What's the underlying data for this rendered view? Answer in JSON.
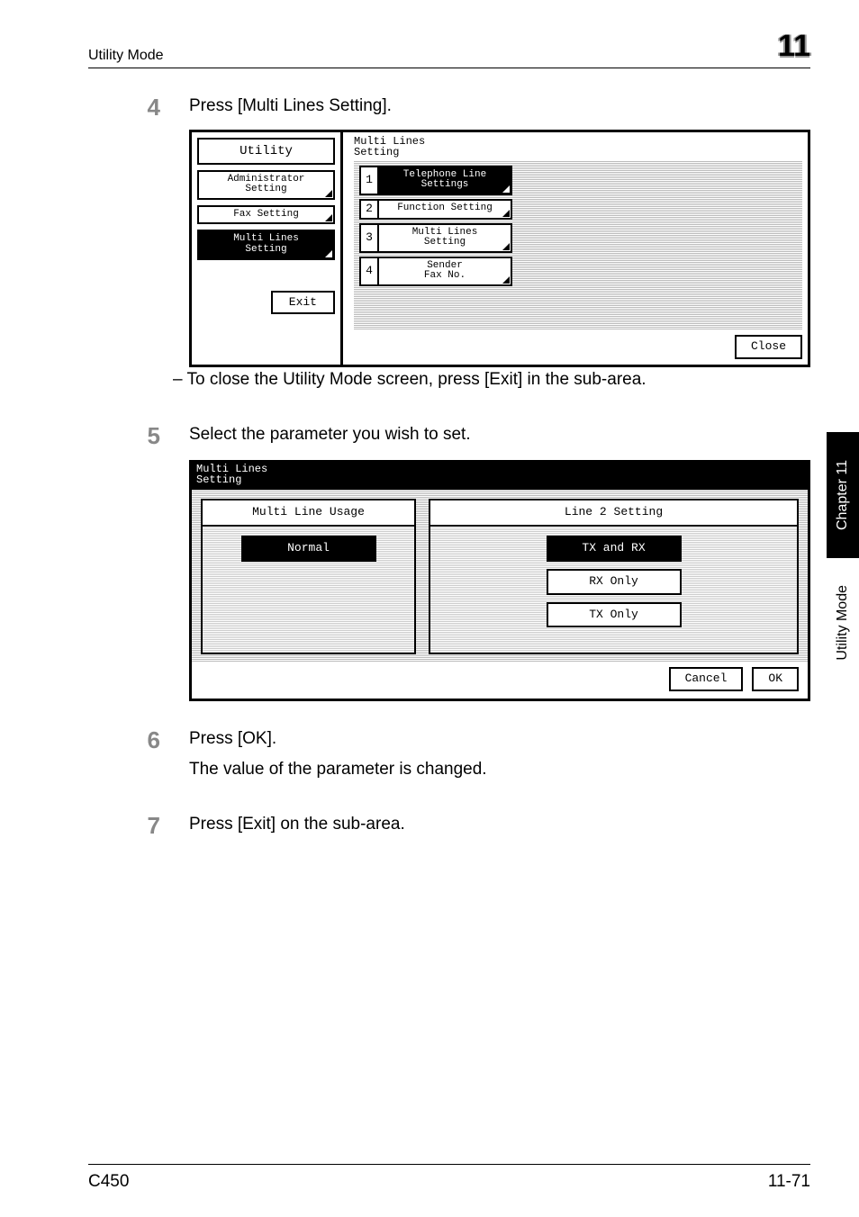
{
  "header": {
    "title": "Utility Mode",
    "chapter_number": "11"
  },
  "side_tab": {
    "chapter_label": "Chapter 11",
    "mode_label": "Utility Mode"
  },
  "steps": {
    "s4": {
      "num": "4",
      "text": "Press [Multi Lines Setting].",
      "sub_dash": "–   To close the Utility Mode screen, press [Exit] in the sub-area."
    },
    "s5": {
      "num": "5",
      "text": "Select the parameter you wish to set."
    },
    "s6": {
      "num": "6",
      "text": "Press [OK].",
      "text2": "The value of the parameter is changed."
    },
    "s7": {
      "num": "7",
      "text": "Press [Exit] on the sub-area."
    }
  },
  "screen1": {
    "sidebar": {
      "title": "Utility",
      "items": [
        {
          "label": "Administrator\nSetting"
        },
        {
          "label": "Fax Setting"
        },
        {
          "label": "Multi Lines\nSetting"
        }
      ],
      "exit": "Exit"
    },
    "main": {
      "title": "Multi Lines\nSetting",
      "items": [
        {
          "n": "1",
          "label": "Telephone Line\nSettings"
        },
        {
          "n": "2",
          "label": "Function Setting"
        },
        {
          "n": "3",
          "label": "Multi Lines\nSetting"
        },
        {
          "n": "4",
          "label": "Sender\nFax No."
        }
      ],
      "close": "Close"
    }
  },
  "screen2": {
    "title": "Multi Lines\nSetting",
    "colA": {
      "head": "Multi Line Usage",
      "items": [
        "Normal"
      ]
    },
    "colB": {
      "head": "Line 2 Setting",
      "items": [
        "TX and RX",
        "RX Only",
        "TX Only"
      ]
    },
    "footer": {
      "cancel": "Cancel",
      "ok": "OK"
    }
  },
  "footer": {
    "left": "C450",
    "right": "11-71"
  }
}
